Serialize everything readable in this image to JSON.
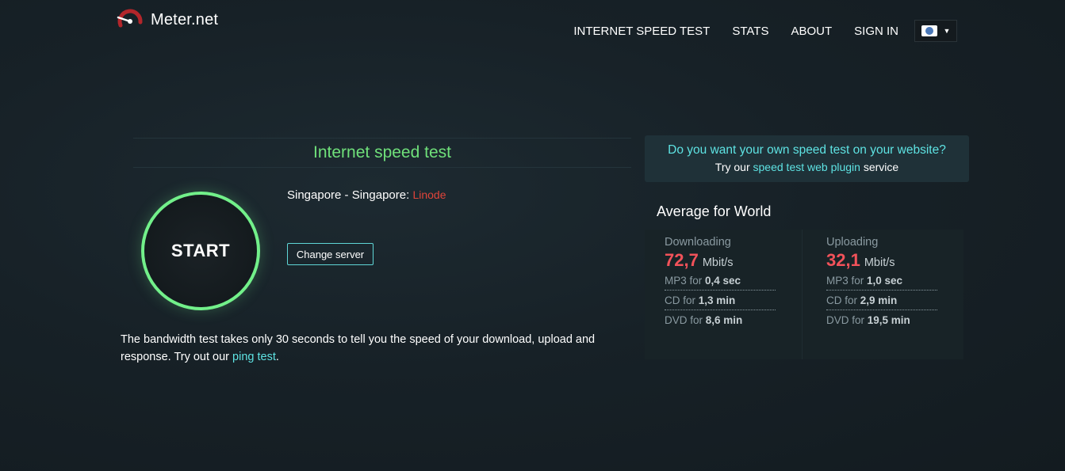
{
  "brand": {
    "name": "Meter.net"
  },
  "nav": {
    "items": [
      {
        "label": "INTERNET SPEED TEST"
      },
      {
        "label": "STATS"
      },
      {
        "label": "ABOUT"
      },
      {
        "label": "SIGN IN"
      }
    ],
    "language_icon": "globe-flag-icon"
  },
  "test": {
    "title": "Internet speed test",
    "start_label": "START",
    "server_location": "Singapore - Singapore:",
    "server_isp": "Linode",
    "change_server_label": "Change server",
    "description_prefix": "The bandwidth test takes only 30 seconds to tell you the speed of your download, upload and response. Try out our ",
    "ping_link": "ping test",
    "description_suffix": "."
  },
  "promo": {
    "question": "Do you want your own speed test on your website?",
    "prefix": "Try our ",
    "link": "speed test web plugin",
    "suffix": " service"
  },
  "average": {
    "title": "Average for World",
    "download": {
      "label": "Downloading",
      "value": "72,7",
      "unit": "Mbit/s",
      "rows": [
        {
          "prefix": "MP3 for ",
          "value": "0,4 sec"
        },
        {
          "prefix": "CD for ",
          "value": "1,3 min"
        },
        {
          "prefix": "DVD for ",
          "value": "8,6 min"
        }
      ]
    },
    "upload": {
      "label": "Uploading",
      "value": "32,1",
      "unit": "Mbit/s",
      "rows": [
        {
          "prefix": "MP3 for ",
          "value": "1,0 sec"
        },
        {
          "prefix": "CD for ",
          "value": "2,9 min"
        },
        {
          "prefix": "DVD for ",
          "value": "19,5 min"
        }
      ]
    }
  },
  "colors": {
    "accent_green": "#6fe07a",
    "accent_cyan": "#5ee3e3",
    "speed_red": "#f2525a",
    "isp_red": "#e0443a"
  }
}
